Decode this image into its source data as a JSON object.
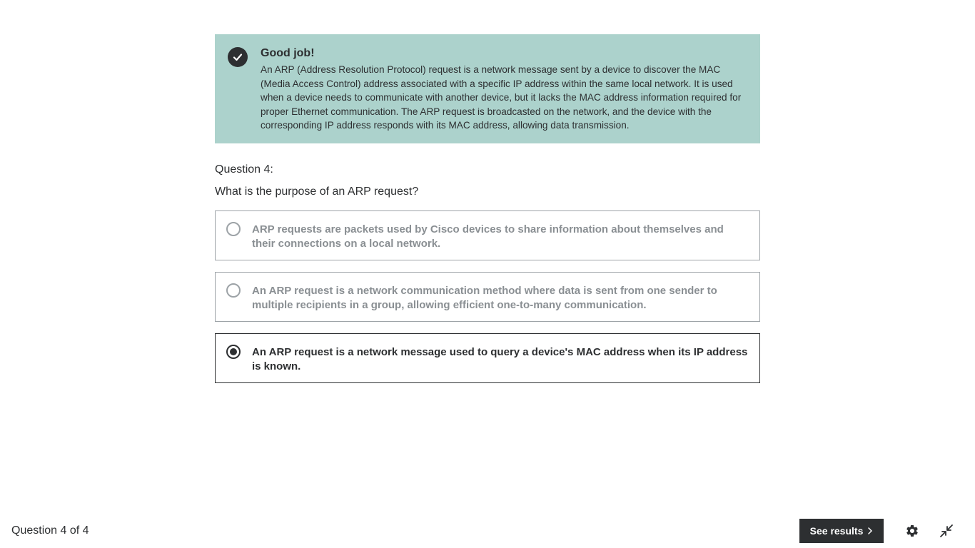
{
  "feedback": {
    "title": "Good job!",
    "text": "An ARP (Address Resolution Protocol) request is a network message sent by a device to discover the MAC (Media Access Control) address associated with a specific IP address within the same local network. It is used when a device needs to communicate with another device, but it lacks the MAC address information required for proper Ethernet communication. The ARP request is broadcasted on the network, and the device with the corresponding IP address responds with its MAC address, allowing data transmission.",
    "icon": "check-circle-icon",
    "color": "#acd2cc"
  },
  "question": {
    "label": "Question 4:",
    "text": "What is the purpose of an ARP request?",
    "options": [
      {
        "label": "ARP requests are packets used by Cisco devices to share information about themselves and their connections on a local network.",
        "selected": false
      },
      {
        "label": "An ARP request is a network communication method where data is sent from one sender to multiple recipients in a group, allowing efficient one-to-many communication.",
        "selected": false
      },
      {
        "label": "An ARP request is a network message used to query a device's MAC address when its IP address is known.",
        "selected": true
      }
    ]
  },
  "footer": {
    "progress": "Question 4 of 4",
    "see_results_label": "See results",
    "settings_icon": "gear-icon",
    "collapse_icon": "collapse-icon"
  }
}
